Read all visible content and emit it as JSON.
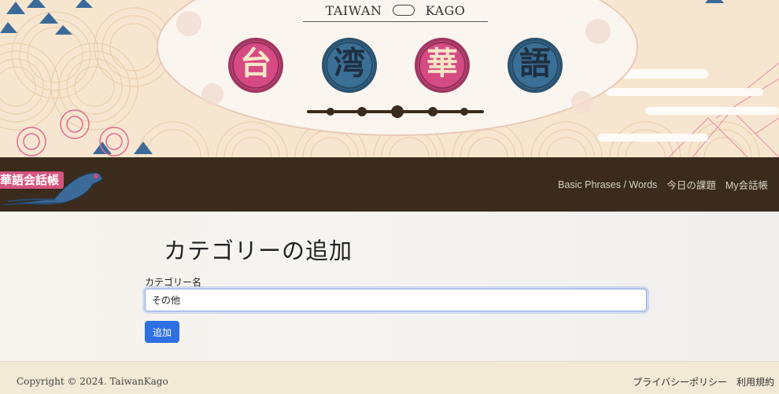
{
  "banner": {
    "kago_left": "TAIWAN",
    "kago_right": "KAGO",
    "chars": [
      "台",
      "湾",
      "華",
      "語"
    ]
  },
  "navbar": {
    "logo_text": "華語会話帳",
    "links": [
      "Basic Phrases / Words",
      "今日の課題",
      "My会話帳"
    ]
  },
  "main": {
    "title": "カテゴリーの追加",
    "field_label": "カテゴリー名",
    "field_value": "その他",
    "add_label": "追加"
  },
  "footer": {
    "copyright": "Copyright © 2024. TaiwanKago",
    "links": [
      "プライバシーポリシー",
      "利用規約"
    ]
  },
  "colors": {
    "navbar": "#3a2b1c",
    "primary": "#2f6fe4",
    "pink": "#d64a83",
    "blue": "#3a6f96"
  }
}
